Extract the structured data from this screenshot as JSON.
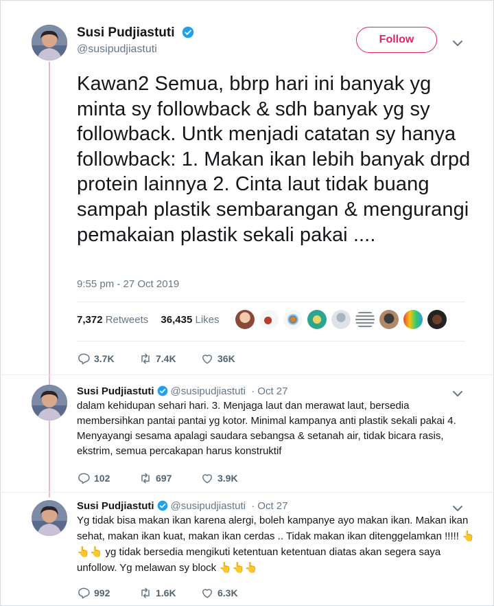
{
  "main_tweet": {
    "author_name": "Susi Pudjiastuti",
    "author_handle": "@susipudjiastuti",
    "follow_label": "Follow",
    "text": "Kawan2 Semua, bbrp hari ini banyak yg minta sy followback & sdh banyak yg sy followback. Untk menjadi catatan sy hanya followback: 1. Makan ikan lebih banyak drpd protein lainnya 2. Cinta laut tidak buang sampah plastik sembarangan & mengurangi pemakaian plastik sekali pakai ....",
    "timestamp": "9:55 pm - 27 Oct 2019",
    "retweets_count": "7,372",
    "retweets_label": "Retweets",
    "likes_count": "36,435",
    "likes_label": "Likes",
    "reply_count": "3.7K",
    "retweet_count_short": "7.4K",
    "like_count_short": "36K"
  },
  "replies": [
    {
      "author_name": "Susi Pudjiastuti",
      "author_handle": "@susipudjiastuti",
      "date": "· Oct 27",
      "text": "dalam kehidupan sehari hari. 3. Menjaga laut dan merawat laut, bersedia membersihkan pantai pantai yg kotor. Minimal kampanya anti plastik sekali pakai 4. Menyayangi sesama apalagi saudara sebangsa & setanah air, tidak bicara rasis, ekstrim, semua percakapan harus konstruktif",
      "reply_count": "102",
      "retweet_count": "697",
      "like_count": "3.9K"
    },
    {
      "author_name": "Susi Pudjiastuti",
      "author_handle": "@susipudjiastuti",
      "date": "· Oct 27",
      "text_part1": "Yg tidak bisa makan ikan karena alergi, boleh kampanye ayo makan ikan. Makan ikan sehat, makan ikan kuat, makan ikan cerdas .. Tidak makan ikan ditenggelamkan !!!!! ",
      "emoji_a": "👆👆👆",
      "text_part2": " yg tidak bersedia mengikuti ketentuan ketentuan diatas akan segera saya unfollow. Yg melawan sy block ",
      "emoji_b": "👆👆👆",
      "reply_count": "992",
      "retweet_count": "1.6K",
      "like_count": "6.3K"
    }
  ],
  "colors": {
    "accent": "#e0245e",
    "verified": "#1da1f2",
    "thread_line": "#f4b4c8",
    "muted": "#657786"
  },
  "icons": [
    "verified-icon",
    "chevron-down-icon",
    "reply-icon",
    "retweet-icon",
    "like-icon"
  ]
}
